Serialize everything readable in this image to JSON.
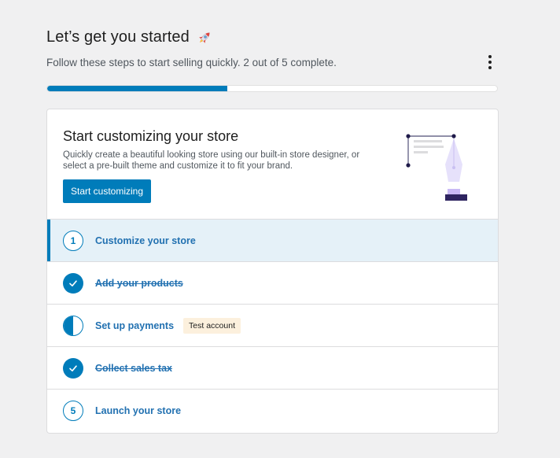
{
  "header": {
    "title": "Let’s get you started",
    "subtitle": "Follow these steps to start selling quickly. 2 out of 5 complete.",
    "progress_fraction": 0.4
  },
  "hero": {
    "title": "Start customizing your store",
    "description": "Quickly create a beautiful looking store using our built-in store designer, or select a pre-built theme and customize it to fit your brand.",
    "button_label": "Start customizing"
  },
  "tasks": [
    {
      "number": "1",
      "label": "Customize your store",
      "state": "active"
    },
    {
      "number": "",
      "label": "Add your products",
      "state": "complete"
    },
    {
      "number": "",
      "label": "Set up payments",
      "state": "partial",
      "badge": "Test account"
    },
    {
      "number": "",
      "label": "Collect sales tax",
      "state": "complete"
    },
    {
      "number": "5",
      "label": "Launch your store",
      "state": "pending"
    }
  ],
  "colors": {
    "accent": "#007cba",
    "link": "#2271b1",
    "badge_bg": "#fcf0dd",
    "active_row_bg": "#e5f1f8"
  },
  "icons": [
    "rocket-icon",
    "more-vertical-icon",
    "pen-illustration",
    "checkmark-icon",
    "half-circle-icon"
  ]
}
